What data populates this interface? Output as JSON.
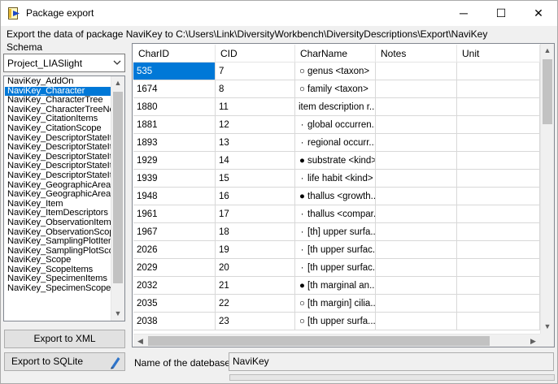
{
  "window": {
    "title": "Package export",
    "icon": "package-export-icon",
    "controls": {
      "minimize": "─",
      "maximize": "☐",
      "close": "✕"
    }
  },
  "info_text": "Export the data of package NaviKey to C:\\Users\\Link\\DiversityWorkbench\\DiversityDescriptions\\Export\\NaviKey",
  "schema": {
    "label": "Schema",
    "selected": "Project_LIASlight"
  },
  "tables": [
    "NaviKey_AddOn",
    "NaviKey_Character",
    "NaviKey_CharacterTree",
    "NaviKey_CharacterTreeNo",
    "NaviKey_CitationItems",
    "NaviKey_CitationScope",
    "NaviKey_DescriptorStateIte",
    "NaviKey_DescriptorStateIte",
    "NaviKey_DescriptorStateIte",
    "NaviKey_DescriptorStateIte",
    "NaviKey_DescriptorStateIt",
    "NaviKey_GeographicAreaIt",
    "NaviKey_GeographicAreaS",
    "NaviKey_Item",
    "NaviKey_ItemDescriptors",
    "NaviKey_ObservationItems",
    "NaviKey_ObservationScop",
    "NaviKey_SamplingPlotItem",
    "NaviKey_SamplingPlotScop",
    "NaviKey_Scope",
    "NaviKey_ScopeItems",
    "NaviKey_SpecimenItems",
    "NaviKey_SpecimenScope"
  ],
  "selected_table_index": 1,
  "buttons": {
    "export_xml": "Export to XML",
    "export_sqlite": "Export to SQLite"
  },
  "grid": {
    "columns": [
      "CharID",
      "CID",
      "CharName",
      "Notes",
      "Unit"
    ],
    "rows": [
      {
        "charid": "535",
        "cid": "7",
        "marker": "○",
        "charname": "genus <taxon>"
      },
      {
        "charid": "1674",
        "cid": "8",
        "marker": "○",
        "charname": "family <taxon>"
      },
      {
        "charid": "1880",
        "cid": "11",
        "marker": "",
        "charname": "item description r..."
      },
      {
        "charid": "1881",
        "cid": "12",
        "marker": "·",
        "charname": "global occurren..."
      },
      {
        "charid": "1893",
        "cid": "13",
        "marker": "·",
        "charname": "regional occurr..."
      },
      {
        "charid": "1929",
        "cid": "14",
        "marker": "●",
        "charname": "substrate <kind>"
      },
      {
        "charid": "1939",
        "cid": "15",
        "marker": "·",
        "charname": "life habit <kind>"
      },
      {
        "charid": "1948",
        "cid": "16",
        "marker": "●",
        "charname": "thallus <growth..."
      },
      {
        "charid": "1961",
        "cid": "17",
        "marker": "·",
        "charname": "thallus <compar..."
      },
      {
        "charid": "1967",
        "cid": "18",
        "marker": "·",
        "charname": "[th] upper surfa..."
      },
      {
        "charid": "2026",
        "cid": "19",
        "marker": "·",
        "charname": "[th upper surfac..."
      },
      {
        "charid": "2029",
        "cid": "20",
        "marker": "·",
        "charname": "[th upper surfac..."
      },
      {
        "charid": "2032",
        "cid": "21",
        "marker": "●",
        "charname": "[th marginal an..."
      },
      {
        "charid": "2035",
        "cid": "22",
        "marker": "○",
        "charname": "[th margin] cilia..."
      },
      {
        "charid": "2038",
        "cid": "23",
        "marker": "○",
        "charname": "[th upper surfa..."
      }
    ]
  },
  "database": {
    "label": "Name of the datebase:",
    "value": "NaviKey"
  }
}
